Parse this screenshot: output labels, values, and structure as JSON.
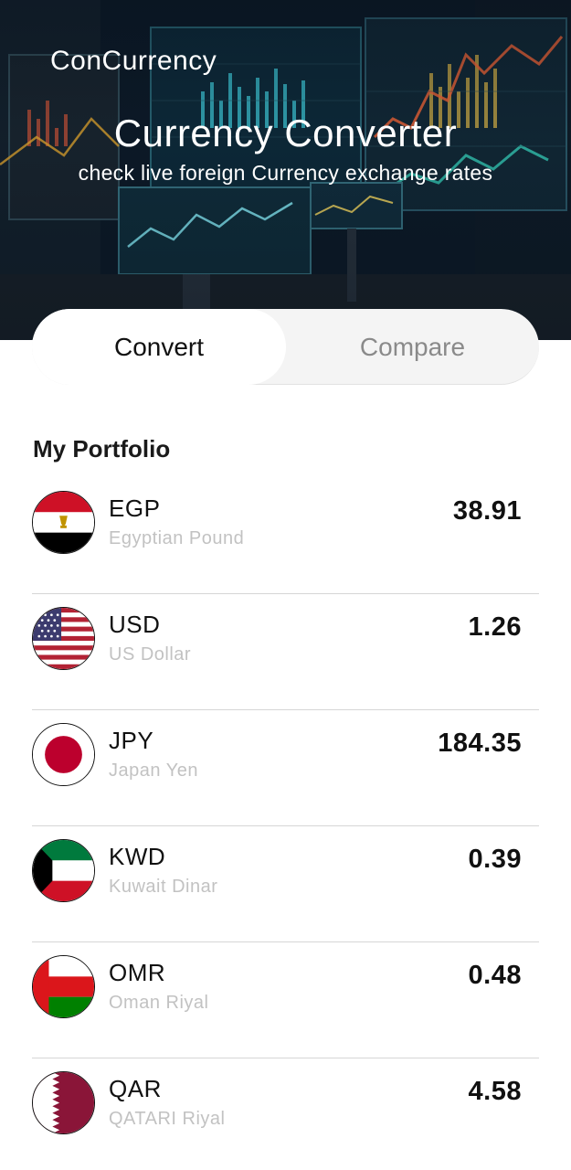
{
  "header": {
    "app_name": "ConCurrency",
    "title": "Currency Converter",
    "subtitle": "check live foreign Currency exchange rates"
  },
  "tabs": [
    {
      "label": "Convert",
      "active": true
    },
    {
      "label": "Compare",
      "active": false
    }
  ],
  "portfolio": {
    "title": "My Portfolio",
    "items": [
      {
        "code": "EGP",
        "name": "Egyptian Pound",
        "value": "38.91",
        "flag_icon": "egypt-flag-icon"
      },
      {
        "code": "USD",
        "name": "US Dollar",
        "value": "1.26",
        "flag_icon": "usa-flag-icon"
      },
      {
        "code": "JPY",
        "name": "Japan Yen",
        "value": "184.35",
        "flag_icon": "japan-flag-icon"
      },
      {
        "code": "KWD",
        "name": "Kuwait Dinar",
        "value": "0.39",
        "flag_icon": "kuwait-flag-icon"
      },
      {
        "code": "OMR",
        "name": "Oman Riyal",
        "value": "0.48",
        "flag_icon": "oman-flag-icon"
      },
      {
        "code": "QAR",
        "name": "QATARI Riyal",
        "value": "4.58",
        "flag_icon": "qatar-flag-icon"
      }
    ]
  },
  "colors": {
    "hero_bg": "#0f2436",
    "text_primary": "#111111",
    "text_secondary": "#c2c2c2",
    "tab_inactive_text": "#8a8a8a"
  }
}
